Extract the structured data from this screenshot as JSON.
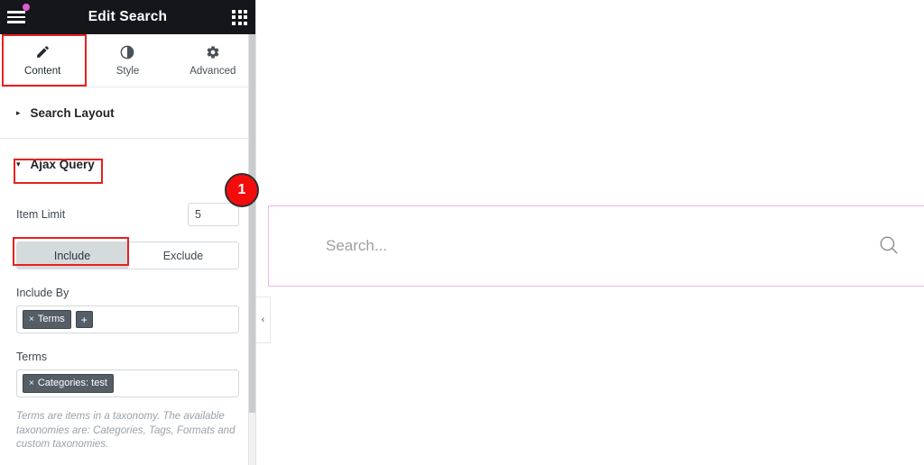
{
  "window": {
    "title": "Edit Search"
  },
  "header": {
    "menu_icon": "hamburger-menu-icon",
    "notification_dot": "notification-dot",
    "apps_icon": "apps-grid-icon"
  },
  "tabs": [
    {
      "label": "Content",
      "icon": "pencil-icon",
      "active": true
    },
    {
      "label": "Style",
      "icon": "contrast-icon",
      "active": false
    },
    {
      "label": "Advanced",
      "icon": "gear-icon",
      "active": false
    }
  ],
  "sections": [
    {
      "title": "Search Layout",
      "expanded": false,
      "caret": "▸"
    },
    {
      "title": "Ajax Query",
      "expanded": true,
      "caret": "▾"
    }
  ],
  "ajax_query": {
    "item_limit_label": "Item Limit",
    "item_limit_value": "5",
    "segmented": {
      "include_label": "Include",
      "exclude_label": "Exclude",
      "selected": "Include"
    },
    "include_by_label": "Include By",
    "include_by_tokens": [
      {
        "remove": "×",
        "label": "Terms"
      }
    ],
    "include_by_add": "+",
    "terms_label": "Terms",
    "terms_tokens": [
      {
        "remove": "×",
        "label": "Categories: test"
      }
    ],
    "help_text": "Terms are items in a taxonomy. The available taxonomies are: Categories, Tags, Formats and custom taxonomies."
  },
  "preview": {
    "search_placeholder": "Search...",
    "search_value": "",
    "search_icon": "magnifier-icon",
    "collapse_chevron": "‹"
  },
  "annotations": {
    "badge_number": "1",
    "highlight_color": "#e8201f",
    "badge_color": "#f40c0c"
  },
  "colors": {
    "header_bg": "#14161a",
    "accent_pink": "#e358d6",
    "widget_outline": "#efb6ec",
    "segment_active_bg": "#d5dadd",
    "token_bg": "#555e67"
  }
}
